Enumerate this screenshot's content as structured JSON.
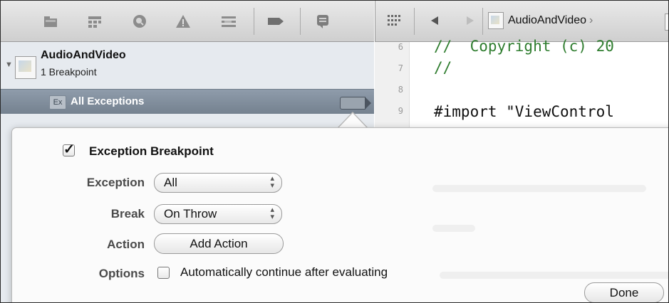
{
  "navigator": {
    "toolbar_icons": [
      "project-navigator-icon",
      "symbol-navigator-icon",
      "search-navigator-icon",
      "issue-navigator-icon",
      "debug-navigator-icon",
      "breakpoint-navigator-icon",
      "log-navigator-icon"
    ],
    "project": {
      "name": "AudioAndVideo",
      "subtitle": "1 Breakpoint"
    },
    "exception_row": {
      "badge": "Ex",
      "label": "All Exceptions"
    }
  },
  "editor": {
    "jump_bar": {
      "file": "AudioAndVideo"
    },
    "lines": [
      {
        "num": "6",
        "text": "//  Copyright (c) 20"
      },
      {
        "num": "7",
        "text": "//"
      },
      {
        "num": "8",
        "text": ""
      },
      {
        "num": "9",
        "text": "#import \"ViewControl"
      }
    ]
  },
  "popover": {
    "title": "Exception Breakpoint",
    "exception": {
      "label": "Exception",
      "value": "All"
    },
    "break": {
      "label": "Break",
      "value": "On Throw"
    },
    "action": {
      "label": "Action",
      "button": "Add Action"
    },
    "options": {
      "label": "Options",
      "text": "Automatically continue after evaluating"
    },
    "done_button": "Done"
  }
}
